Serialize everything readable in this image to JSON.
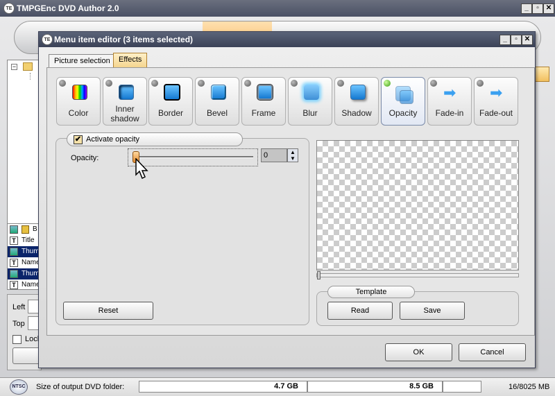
{
  "main": {
    "title": "TMPGEnc DVD Author 2.0",
    "app_icon": "TE",
    "window_buttons": {
      "minimize": "_",
      "maximize": "▫",
      "close": "✕"
    },
    "items": [
      {
        "label": "B",
        "type": "image",
        "selected": false
      },
      {
        "label": "Title",
        "type": "text",
        "selected": false
      },
      {
        "label": "Thum",
        "type": "image",
        "selected": true
      },
      {
        "label": "Name",
        "type": "text",
        "selected": false
      },
      {
        "label": "Thum",
        "type": "image",
        "selected": true
      },
      {
        "label": "Name",
        "type": "text",
        "selected": false
      }
    ],
    "position": {
      "left_label": "Left",
      "top_label": "Top",
      "lock_label": "Lock"
    },
    "status": {
      "ntsc": "NTSC",
      "label": "Size of output DVD folder:",
      "size1": "4.7 GB",
      "size2": "8.5 GB",
      "free": "16/8025 MB"
    }
  },
  "dialog": {
    "title": "Menu item editor (3 items selected)",
    "tabs": [
      "Picture selection",
      "Effects"
    ],
    "active_tab": "Effects",
    "effects": [
      {
        "label": "Color",
        "active": false
      },
      {
        "label": "Inner shadow",
        "active": false
      },
      {
        "label": "Border",
        "active": false
      },
      {
        "label": "Bevel",
        "active": false
      },
      {
        "label": "Frame",
        "active": false
      },
      {
        "label": "Blur",
        "active": false
      },
      {
        "label": "Shadow",
        "active": false
      },
      {
        "label": "Opacity",
        "active": true
      },
      {
        "label": "Fade-in",
        "active": false
      },
      {
        "label": "Fade-out",
        "active": false
      }
    ],
    "activate_label": "Activate opacity",
    "activate_checked": "✔",
    "opacity_label": "Opacity:",
    "opacity_value": "0",
    "reset_label": "Reset",
    "template_label": "Template",
    "read_label": "Read",
    "save_label": "Save",
    "ok_label": "OK",
    "cancel_label": "Cancel"
  },
  "colors": {
    "accent": "#f4d48c",
    "selection": "#0a246a",
    "title_bar": "#4a5064"
  }
}
